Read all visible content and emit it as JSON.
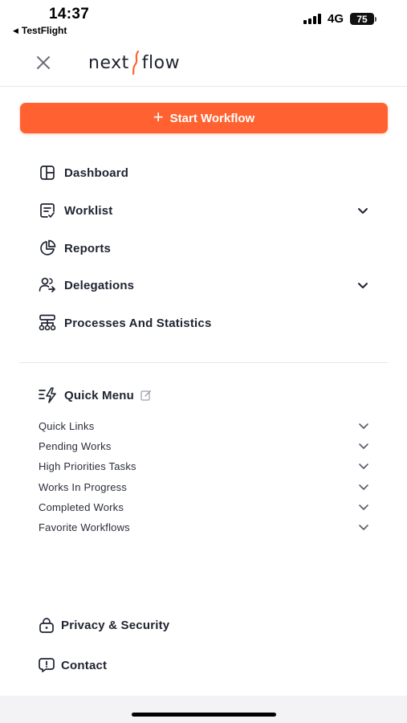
{
  "status_bar": {
    "time": "14:37",
    "back_app": "TestFlight",
    "network": "4G",
    "battery": "75"
  },
  "header": {
    "logo_left": "next",
    "logo_right": "flow",
    "close_icon": "close-icon"
  },
  "start_button": {
    "label": "Start Workflow",
    "icon": "plus-icon",
    "color": "#ff6230"
  },
  "nav": {
    "items": [
      {
        "label": "Dashboard",
        "icon": "dashboard-icon",
        "has_chevron": false
      },
      {
        "label": "Worklist",
        "icon": "worklist-icon",
        "has_chevron": true
      },
      {
        "label": "Reports",
        "icon": "pie-chart-icon",
        "has_chevron": false
      },
      {
        "label": "Delegations",
        "icon": "delegation-icon",
        "has_chevron": true
      },
      {
        "label": "Processes And Statistics",
        "icon": "hierarchy-icon",
        "has_chevron": false
      }
    ]
  },
  "quick_menu": {
    "title": "Quick Menu",
    "icon": "quick-menu-icon",
    "edit_icon": "edit-icon",
    "items": [
      {
        "label": "Quick Links"
      },
      {
        "label": "Pending Works"
      },
      {
        "label": "High Priorities Tasks"
      },
      {
        "label": "Works In Progress"
      },
      {
        "label": "Completed Works"
      },
      {
        "label": "Favorite Workflows"
      }
    ]
  },
  "bottom": {
    "privacy_label": "Privacy & Security",
    "contact_label": "Contact"
  }
}
